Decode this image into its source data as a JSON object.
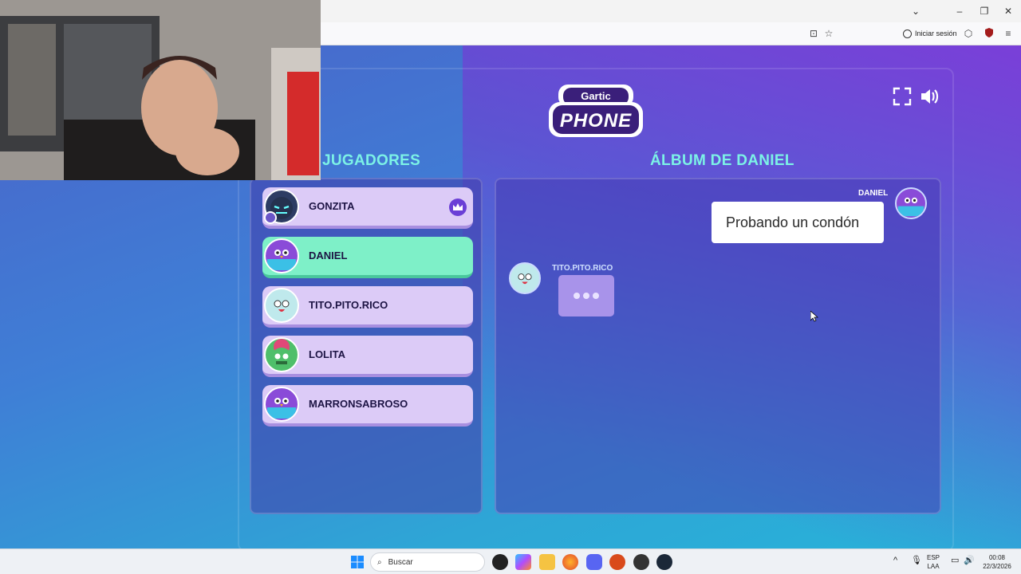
{
  "browser": {
    "signin_label": "Iniciar sesión"
  },
  "game": {
    "logo_top": "Gartic",
    "logo_bottom": "PHONE",
    "players_title": "JUGADORES",
    "album_title": "ÁLBUM DE DANIEL",
    "players": [
      {
        "name": "GONZITA",
        "host": true,
        "active": false
      },
      {
        "name": "DANIEL",
        "host": false,
        "active": true
      },
      {
        "name": "TITO.PITO.RICO",
        "host": false,
        "active": false
      },
      {
        "name": "LOLITA",
        "host": false,
        "active": false
      },
      {
        "name": "MARRONSABROSO",
        "host": false,
        "active": false
      }
    ],
    "messages": [
      {
        "author": "DANIEL",
        "text": "Probando un condón"
      },
      {
        "author": "TITO.PITO.RICO",
        "text": ""
      }
    ]
  },
  "taskbar": {
    "search_placeholder": "Buscar",
    "lang_top": "ESP",
    "lang_bottom": "LAA",
    "time": "00:08",
    "date": "22/3/2026"
  },
  "colors": {
    "accent_title": "#7cf2e6",
    "player_bg": "#dccbf7",
    "player_active": "#7ef0c8",
    "bubble_typing": "#a893ea"
  }
}
